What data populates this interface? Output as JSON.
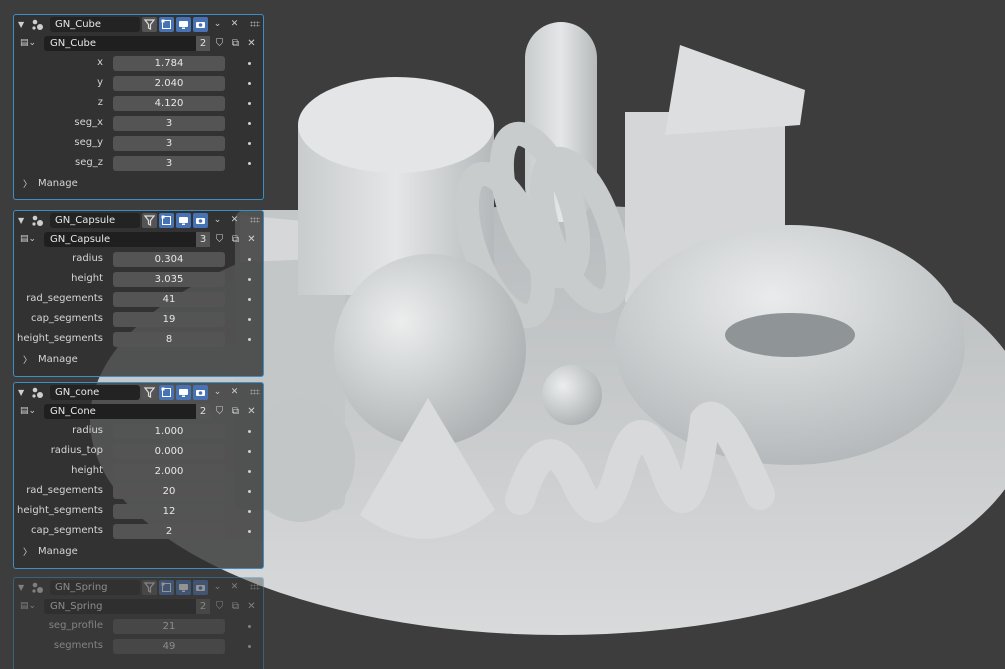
{
  "panels": [
    {
      "name": "GN_Cube",
      "datablock": "GN_Cube",
      "users": "2",
      "params": [
        {
          "label": "x",
          "value": "1.784"
        },
        {
          "label": "y",
          "value": "2.040"
        },
        {
          "label": "z",
          "value": "4.120"
        },
        {
          "label": "seg_x",
          "value": "3"
        },
        {
          "label": "seg_y",
          "value": "3"
        },
        {
          "label": "seg_z",
          "value": "3"
        }
      ],
      "manage_label": "Manage"
    },
    {
      "name": "GN_Capsule",
      "datablock": "GN_Capsule",
      "users": "3",
      "params": [
        {
          "label": "radius",
          "value": "0.304"
        },
        {
          "label": "height",
          "value": "3.035"
        },
        {
          "label": "rad_segements",
          "value": "41"
        },
        {
          "label": "cap_segments",
          "value": "19"
        },
        {
          "label": "height_segments",
          "value": "8"
        }
      ],
      "manage_label": "Manage"
    },
    {
      "name": "GN_cone",
      "datablock": "GN_Cone",
      "users": "2",
      "params": [
        {
          "label": "radius",
          "value": "1.000"
        },
        {
          "label": "radius_top",
          "value": "0.000"
        },
        {
          "label": "height",
          "value": "2.000"
        },
        {
          "label": "rad_segements",
          "value": "20"
        },
        {
          "label": "height_segments",
          "value": "12"
        },
        {
          "label": "cap_segments",
          "value": "2"
        }
      ],
      "manage_label": "Manage"
    },
    {
      "name": "GN_Spring",
      "datablock": "GN_Spring",
      "users": "2",
      "params": [
        {
          "label": "seg_profile",
          "value": "21"
        },
        {
          "label": "segments",
          "value": "49"
        }
      ]
    }
  ],
  "colors": {
    "background": "#3d3d3d",
    "panel_outline": "#3c8fc4",
    "toggle_active": "#4772b3",
    "field": "#545454",
    "geometry": "#c8cacb"
  },
  "icons": [
    "chevron-down-icon",
    "geometry-nodes-icon",
    "funnel-icon",
    "edit-mode-icon",
    "viewport-display-icon",
    "render-camera-icon",
    "close-icon",
    "drag-grip-icon",
    "shield-icon",
    "duplicate-icon",
    "chevron-right-icon"
  ]
}
